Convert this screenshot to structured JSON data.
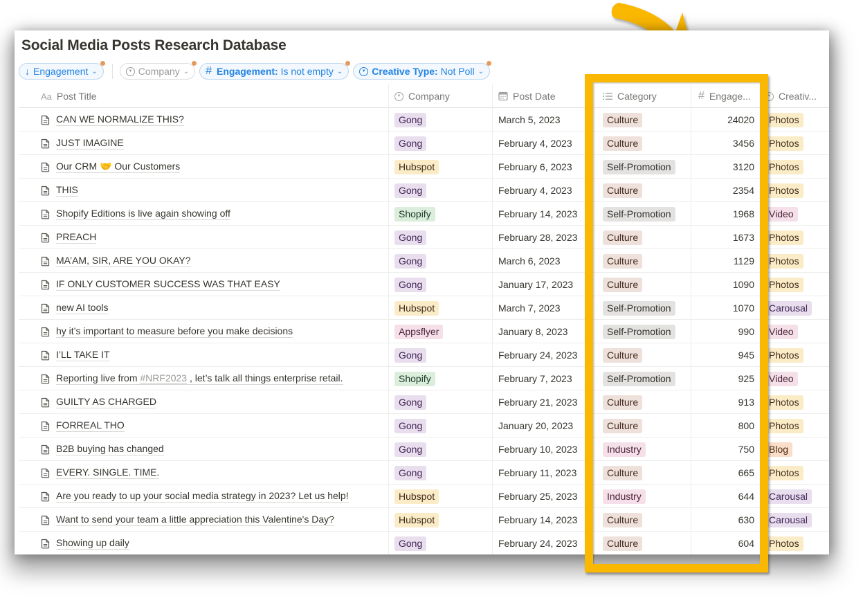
{
  "page": {
    "title": "Social Media Posts Research Database"
  },
  "filters": [
    {
      "icon": "arrow-down-icon",
      "label": "Engagement",
      "bold": "",
      "style": "active"
    },
    {
      "icon": "select-circle-icon",
      "label": "Company",
      "bold": "",
      "style": "plain"
    },
    {
      "icon": "hash-icon",
      "bold": "Engagement:",
      "label": " Is not empty",
      "style": "active"
    },
    {
      "icon": "select-circle-icon",
      "bold": "Creative Type:",
      "label": " Not Poll",
      "style": "active"
    }
  ],
  "columns": {
    "title": {
      "icon": "Aa",
      "label": "Post Title"
    },
    "company": {
      "icon": "select-circle-icon",
      "label": "Company"
    },
    "date": {
      "icon": "calendar-icon",
      "label": "Post Date"
    },
    "category": {
      "icon": "list-icon",
      "label": "Category"
    },
    "engagement": {
      "icon": "#",
      "label": "Engage..."
    },
    "creative": {
      "icon": "select-circle-icon",
      "label": "Creativ..."
    }
  },
  "tag_colors": {
    "Gong": {
      "bg": "#e8deee",
      "fg": "#412454"
    },
    "Hubspot": {
      "bg": "#fbecc8",
      "fg": "#402c1b"
    },
    "Shopify": {
      "bg": "#dbeddb",
      "fg": "#1c3829"
    },
    "Appsflyer": {
      "bg": "#f5e0e9",
      "fg": "#4c2337"
    },
    "Culture": {
      "bg": "#eee0da",
      "fg": "#442a1e"
    },
    "Self-Promotion": {
      "bg": "#e3e2e0",
      "fg": "#32302c"
    },
    "Industry": {
      "bg": "#f5e0e9",
      "fg": "#4c2337"
    },
    "Photos": {
      "bg": "#fbecc8",
      "fg": "#402c1b"
    },
    "Video": {
      "bg": "#f5e0e9",
      "fg": "#4c2337"
    },
    "Carousal": {
      "bg": "#e8deee",
      "fg": "#412454"
    },
    "Blog": {
      "bg": "#fadec9",
      "fg": "#49290e"
    }
  },
  "rows": [
    {
      "title": "CAN WE NORMALIZE THIS?",
      "company": "Gong",
      "date": "March 5, 2023",
      "category": "Culture",
      "engagement": "24020",
      "creative": "Photos"
    },
    {
      "title": "JUST IMAGINE",
      "company": "Gong",
      "date": "February 4, 2023",
      "category": "Culture",
      "engagement": "3456",
      "creative": "Photos"
    },
    {
      "title": "Our CRM  🤝 Our Customers",
      "company": "Hubspot",
      "date": "February 6, 2023",
      "category": "Self-Promotion",
      "engagement": "3120",
      "creative": "Photos"
    },
    {
      "title": "THIS",
      "company": "Gong",
      "date": "February 4, 2023",
      "category": "Culture",
      "engagement": "2354",
      "creative": "Photos"
    },
    {
      "title": "Shopify Editions is live again showing off",
      "company": "Shopify",
      "date": "February 14, 2023",
      "category": "Self-Promotion",
      "engagement": "1968",
      "creative": "Video"
    },
    {
      "title": "PREACH",
      "company": "Gong",
      "date": "February 28, 2023",
      "category": "Culture",
      "engagement": "1673",
      "creative": "Photos"
    },
    {
      "title": "MA’AM, SIR, ARE YOU OKAY?",
      "company": "Gong",
      "date": "March 6, 2023",
      "category": "Culture",
      "engagement": "1129",
      "creative": "Photos"
    },
    {
      "title": "IF ONLY CUSTOMER SUCCESS WAS THAT EASY",
      "company": "Gong",
      "date": "January 17, 2023",
      "category": "Culture",
      "engagement": "1090",
      "creative": "Photos"
    },
    {
      "title": "new AI tools",
      "company": "Hubspot",
      "date": "March 7, 2023",
      "category": "Self-Promotion",
      "engagement": "1070",
      "creative": "Carousal"
    },
    {
      "title": "hy it’s important to measure before you make decisions",
      "company": "Appsflyer",
      "date": "January 8, 2023",
      "category": "Self-Promotion",
      "engagement": "990",
      "creative": "Video"
    },
    {
      "title": "I’LL TAKE IT",
      "company": "Gong",
      "date": "February 24, 2023",
      "category": "Culture",
      "engagement": "945",
      "creative": "Photos"
    },
    {
      "title_pre": "Reporting live from ",
      "title_hash": "#NRF2023",
      "title_post": " , let’s talk all things enterprise retail.",
      "company": "Shopify",
      "date": "February 7, 2023",
      "category": "Self-Promotion",
      "engagement": "925",
      "creative": "Video"
    },
    {
      "title": "GUILTY AS CHARGED",
      "company": "Gong",
      "date": "February 21, 2023",
      "category": "Culture",
      "engagement": "913",
      "creative": "Photos"
    },
    {
      "title": "FORREAL THO",
      "company": "Gong",
      "date": "January 20, 2023",
      "category": "Culture",
      "engagement": "800",
      "creative": "Photos"
    },
    {
      "title": "B2B buying has changed",
      "company": "Gong",
      "date": "February 10, 2023",
      "category": "Industry",
      "engagement": "750",
      "creative": "Blog"
    },
    {
      "title": "EVERY. SINGLE. TIME.",
      "company": "Gong",
      "date": "February 11, 2023",
      "category": "Culture",
      "engagement": "665",
      "creative": "Photos"
    },
    {
      "title": "Are you ready to up your social media strategy in 2023? Let us help!",
      "company": "Hubspot",
      "date": "February 25, 2023",
      "category": "Industry",
      "engagement": "644",
      "creative": "Carousal"
    },
    {
      "title": "Want to send your team a little appreciation this Valentine's Day?",
      "company": "Hubspot",
      "date": "February 14, 2023",
      "category": "Culture",
      "engagement": "630",
      "creative": "Carousal"
    },
    {
      "title": "Showing up daily",
      "company": "Gong",
      "date": "February 24, 2023",
      "category": "Culture",
      "engagement": "604",
      "creative": "Photos"
    }
  ],
  "annotation": {
    "highlight_color": "#fbb802",
    "highlighted_columns": [
      "Category",
      "Engagement"
    ]
  }
}
